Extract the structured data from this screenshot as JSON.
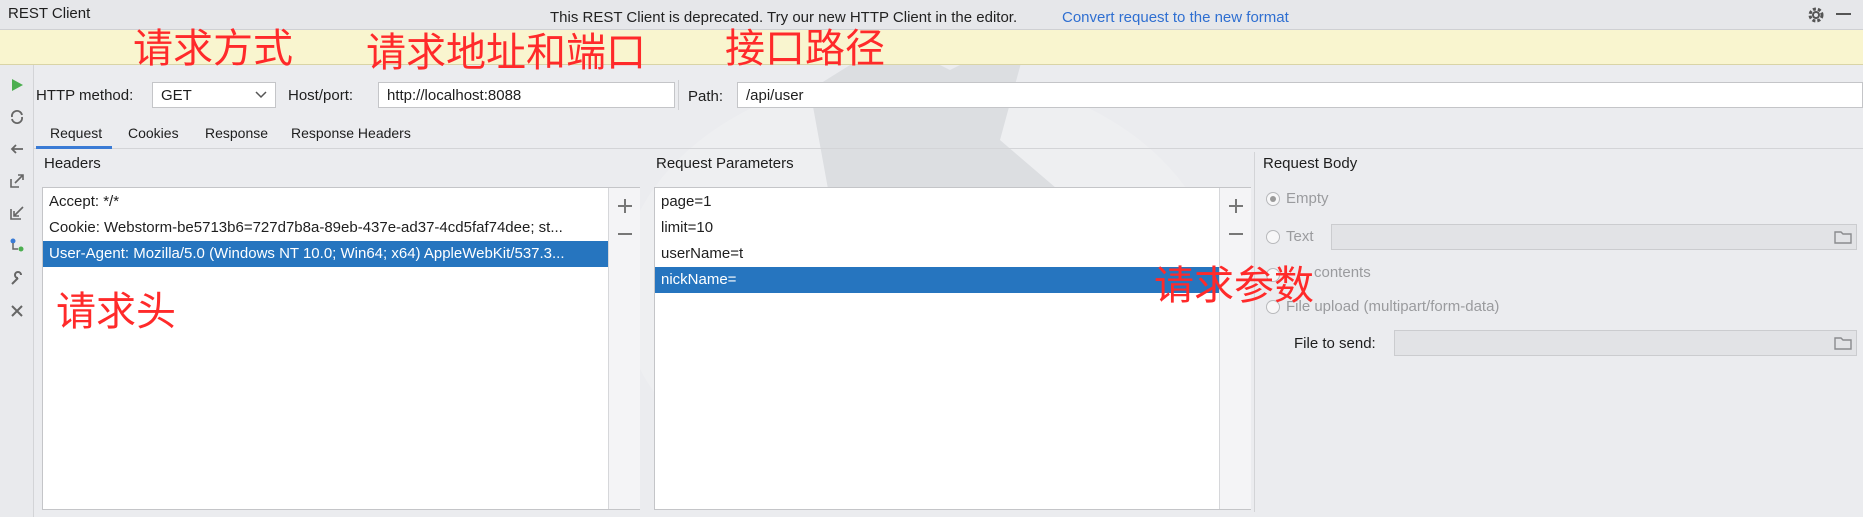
{
  "window": {
    "title": "REST Client"
  },
  "banner": {
    "text": "This REST Client is deprecated. Try our new HTTP Client in the editor.",
    "link": "Convert request to the new format"
  },
  "request_line": {
    "method_label": "HTTP method:",
    "method_value": "GET",
    "host_label": "Host/port:",
    "host_value": "http://localhost:8088",
    "path_label": "Path:",
    "path_value": "/api/user"
  },
  "tabs": [
    {
      "label": "Request",
      "active": true
    },
    {
      "label": "Cookies"
    },
    {
      "label": "Response"
    },
    {
      "label": "Response Headers"
    }
  ],
  "headers": {
    "title": "Headers",
    "items": [
      {
        "text": "Accept: */*"
      },
      {
        "text": "Cookie: Webstorm-be5713b6=727d7b8a-89eb-437e-ad37-4cd5faf74dee; st..."
      },
      {
        "text": "User-Agent: Mozilla/5.0 (Windows NT 10.0; Win64; x64) AppleWebKit/537.3...",
        "selected": true
      }
    ]
  },
  "params": {
    "title": "Request Parameters",
    "items": [
      {
        "text": "page=1"
      },
      {
        "text": "limit=10"
      },
      {
        "text": "userName=t"
      },
      {
        "text": "nickName=",
        "selected": true
      }
    ]
  },
  "body": {
    "title": "Request Body",
    "options": {
      "empty": "Empty",
      "text": "Text",
      "file_contents": "contents",
      "file_upload": "File upload (multipart/form-data)"
    },
    "file_to_send_label": "File to send:"
  },
  "annotations": {
    "method": "请求方式",
    "address": "请求地址和端口",
    "path": "接口路径",
    "headers": "请求头",
    "params": "请求参数"
  },
  "colors": {
    "accent": "#2675bf",
    "banner": "#f9f5cf",
    "link": "#2f6fd1",
    "annotation": "#ff2a2a"
  }
}
